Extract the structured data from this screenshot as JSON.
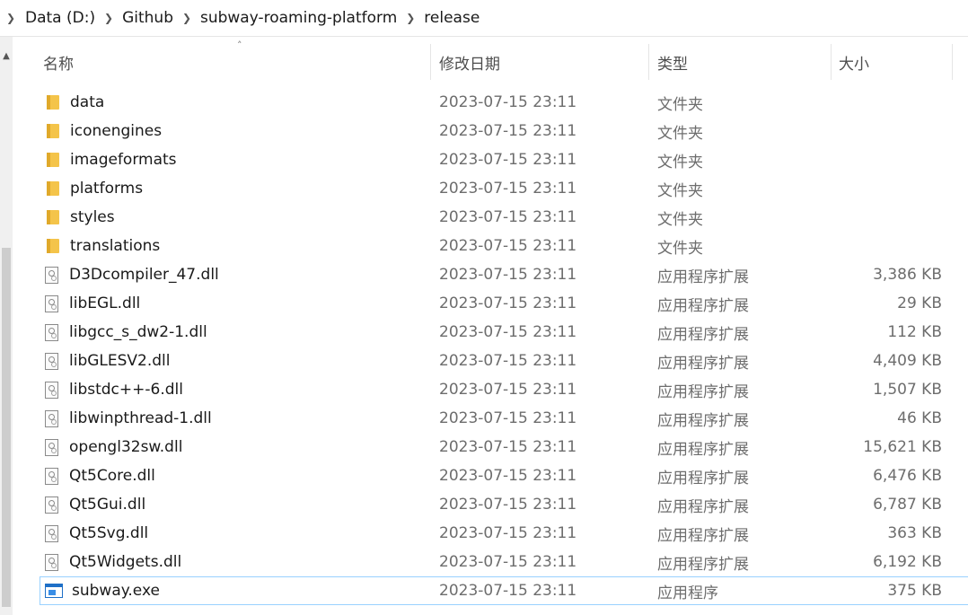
{
  "breadcrumb": [
    "Data (D:)",
    "Github",
    "subway-roaming-platform",
    "release"
  ],
  "columns": {
    "name": "名称",
    "date": "修改日期",
    "type": "类型",
    "size": "大小"
  },
  "files": [
    {
      "name": "data",
      "date": "2023-07-15 23:11",
      "type": "文件夹",
      "size": "",
      "icon": "folder-icon"
    },
    {
      "name": "iconengines",
      "date": "2023-07-15 23:11",
      "type": "文件夹",
      "size": "",
      "icon": "folder-icon"
    },
    {
      "name": "imageformats",
      "date": "2023-07-15 23:11",
      "type": "文件夹",
      "size": "",
      "icon": "folder-icon"
    },
    {
      "name": "platforms",
      "date": "2023-07-15 23:11",
      "type": "文件夹",
      "size": "",
      "icon": "folder-icon"
    },
    {
      "name": "styles",
      "date": "2023-07-15 23:11",
      "type": "文件夹",
      "size": "",
      "icon": "folder-icon"
    },
    {
      "name": "translations",
      "date": "2023-07-15 23:11",
      "type": "文件夹",
      "size": "",
      "icon": "folder-icon"
    },
    {
      "name": "D3Dcompiler_47.dll",
      "date": "2023-07-15 23:11",
      "type": "应用程序扩展",
      "size": "3,386 KB",
      "icon": "dll-icon"
    },
    {
      "name": "libEGL.dll",
      "date": "2023-07-15 23:11",
      "type": "应用程序扩展",
      "size": "29 KB",
      "icon": "dll-icon"
    },
    {
      "name": "libgcc_s_dw2-1.dll",
      "date": "2023-07-15 23:11",
      "type": "应用程序扩展",
      "size": "112 KB",
      "icon": "dll-icon"
    },
    {
      "name": "libGLESV2.dll",
      "date": "2023-07-15 23:11",
      "type": "应用程序扩展",
      "size": "4,409 KB",
      "icon": "dll-icon"
    },
    {
      "name": "libstdc++-6.dll",
      "date": "2023-07-15 23:11",
      "type": "应用程序扩展",
      "size": "1,507 KB",
      "icon": "dll-icon"
    },
    {
      "name": "libwinpthread-1.dll",
      "date": "2023-07-15 23:11",
      "type": "应用程序扩展",
      "size": "46 KB",
      "icon": "dll-icon"
    },
    {
      "name": "opengl32sw.dll",
      "date": "2023-07-15 23:11",
      "type": "应用程序扩展",
      "size": "15,621 KB",
      "icon": "dll-icon"
    },
    {
      "name": "Qt5Core.dll",
      "date": "2023-07-15 23:11",
      "type": "应用程序扩展",
      "size": "6,476 KB",
      "icon": "dll-icon"
    },
    {
      "name": "Qt5Gui.dll",
      "date": "2023-07-15 23:11",
      "type": "应用程序扩展",
      "size": "6,787 KB",
      "icon": "dll-icon"
    },
    {
      "name": "Qt5Svg.dll",
      "date": "2023-07-15 23:11",
      "type": "应用程序扩展",
      "size": "363 KB",
      "icon": "dll-icon"
    },
    {
      "name": "Qt5Widgets.dll",
      "date": "2023-07-15 23:11",
      "type": "应用程序扩展",
      "size": "6,192 KB",
      "icon": "dll-icon"
    },
    {
      "name": "subway.exe",
      "date": "2023-07-15 23:11",
      "type": "应用程序",
      "size": "375 KB",
      "icon": "exe-icon",
      "selected": true
    }
  ],
  "colors": {
    "selection_border": "#99d1ff",
    "folder": "#f4c44a",
    "exe_accent": "#1e6fc7"
  }
}
